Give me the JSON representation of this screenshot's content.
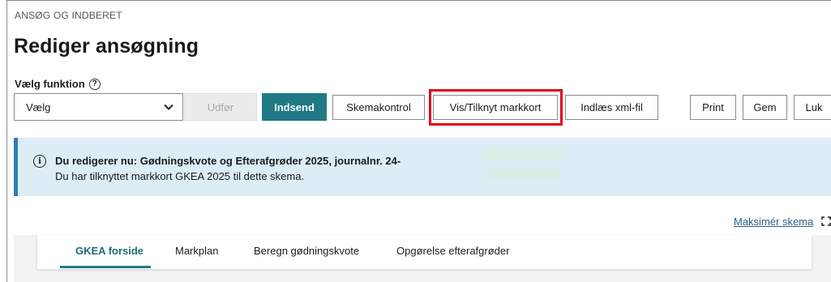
{
  "breadcrumb": "ANSØG OG INDBERET",
  "page_title": "Rediger ansøgning",
  "function_label": "Vælg funktion",
  "help_icon_glyph": "?",
  "select": {
    "value": "Vælg"
  },
  "buttons": {
    "udfor": "Udfør",
    "indsend": "Indsend",
    "skemakontrol": "Skemakontrol",
    "vis_markkort": "Vis/Tilknyt markkort",
    "indlaes_xml": "Indlæs xml-fil",
    "print": "Print",
    "gem": "Gem",
    "luk": "Luk"
  },
  "info": {
    "icon_glyph": "i",
    "line1": "Du redigerer nu: Gødningskvote og Efterafgrøder 2025, journalnr. 24-",
    "line2": "Du har tilknyttet markkort GKEA 2025 til dette skema."
  },
  "maximize_link": "Maksimér skema",
  "tabs": [
    {
      "label": "GKEA forside",
      "active": true
    },
    {
      "label": "Markplan",
      "active": false
    },
    {
      "label": "Beregn gødningskvote",
      "active": false
    },
    {
      "label": "Opgørelse efterafgrøder",
      "active": false
    }
  ],
  "colors": {
    "primary": "#1f7a85",
    "info_bg": "#dcedf6",
    "info_border": "#2f7fb5",
    "highlight": "#e0001b",
    "link": "#2b5f8a"
  }
}
